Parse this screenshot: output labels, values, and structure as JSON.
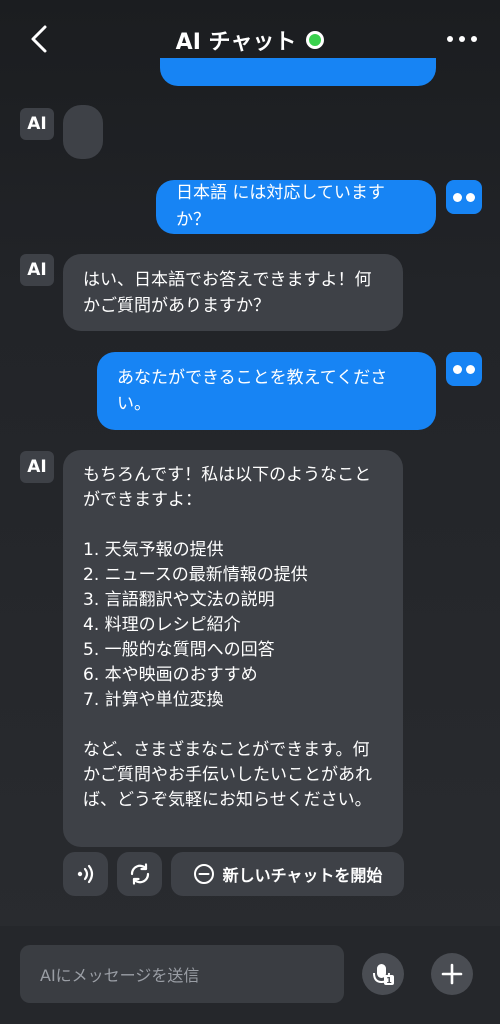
{
  "header": {
    "title": "AI チャット",
    "status_color": "#3ad14e",
    "back_icon": "chevron-left-icon",
    "more_icon": "more-dots-icon"
  },
  "avatars": {
    "ai_label": "AI"
  },
  "messages": [
    {
      "role": "user",
      "text": "日本語 には対応していますか？"
    },
    {
      "role": "ai",
      "text": "はい、日本語でお答えできますよ！何かご質問がありますか？"
    },
    {
      "role": "user",
      "text": "あなたができることを教えてください。"
    },
    {
      "role": "ai",
      "intro": "もちろんです！私は以下のようなことができますよ：",
      "list": [
        "1. 天気予報の提供",
        "2. ニュースの最新情報の提供",
        "3. 言語翻訳や文法の説明",
        "4. 料理のレシピ紹介",
        "5. 一般的な質問への回答",
        "6. 本や映画のおすすめ",
        "7. 計算や単位変換"
      ],
      "outro": "など、さまざまなことができます。何かご質問やお手伝いしたいことがあれば、どうぞ気軽にお知らせください。"
    }
  ],
  "actions": {
    "speak_icon": "speaker-icon",
    "regenerate_icon": "refresh-icon",
    "new_chat_label": "新しいチャットを開始"
  },
  "composer": {
    "placeholder": "AIにメッセージを送信",
    "voice_icon": "voice-input-icon",
    "add_icon": "plus-icon"
  },
  "colors": {
    "user_bubble": "#1784f4",
    "ai_bubble": "#3e4147"
  }
}
